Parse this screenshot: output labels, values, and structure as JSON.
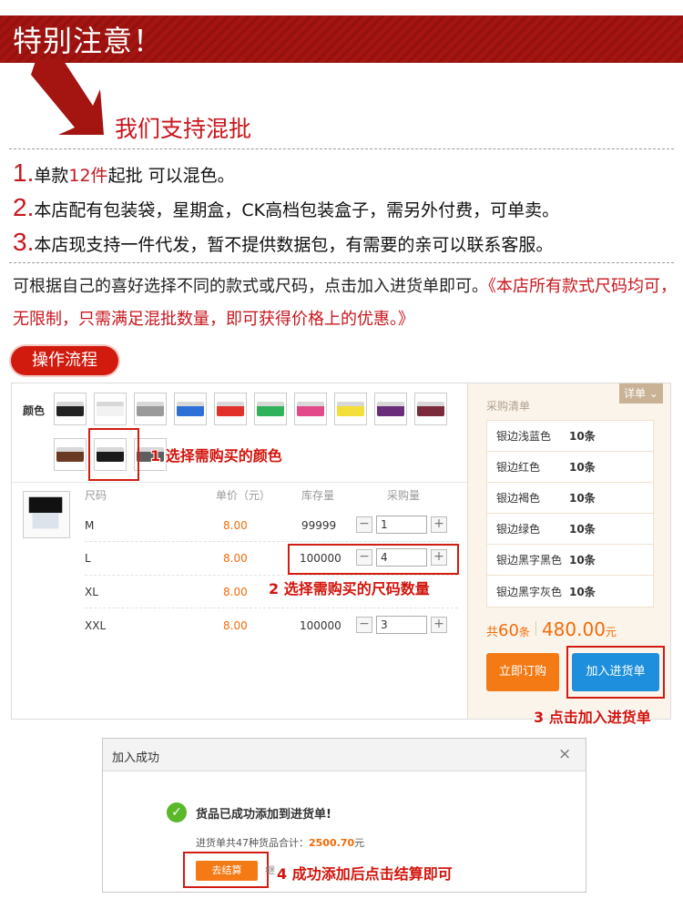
{
  "banner": {
    "title": "特别注意！"
  },
  "subtitle": "我们支持混批",
  "rules": [
    {
      "num": "1.",
      "pre": "单款",
      "hl": "12件",
      "post": "起批 可以混色。"
    },
    {
      "num": "2.",
      "pre": "本店配有包装袋，星期盒，CK高档包装盒子，需另外付费，可单卖。",
      "hl": "",
      "post": ""
    },
    {
      "num": "3.",
      "pre": "本店现支持一件代发，暂不提供数据包，有需要的亲可以联系客服。",
      "hl": "",
      "post": ""
    }
  ],
  "note": {
    "plain": "可根据自己的喜好选择不同的款式或尺码，点击加入进货单即可。",
    "red": "《本店所有款式尺码均可，无限制，只需满足混批数量，即可获得价格上的优惠。》"
  },
  "flow_label": "操作流程",
  "panel": {
    "color_label": "颜色",
    "swatches": [
      {
        "color": "#222222"
      },
      {
        "color": "#f2f2f2"
      },
      {
        "color": "#9a9a9a"
      },
      {
        "color": "#2f6fd8"
      },
      {
        "color": "#e2302a"
      },
      {
        "color": "#2fb25a"
      },
      {
        "color": "#e24a8a"
      },
      {
        "color": "#f2df3a"
      },
      {
        "color": "#6a2d7a"
      },
      {
        "color": "#7a2a3a"
      },
      {
        "color": "#6b3a24"
      },
      {
        "color": "#1a1a1a"
      },
      {
        "color": "#5e5e5e"
      }
    ],
    "headers": {
      "size": "尺码",
      "price": "单价（元）",
      "stock": "库存量",
      "buy": "采购量"
    },
    "rows": [
      {
        "size": "M",
        "price": "8.00",
        "stock": "99999",
        "qty": "1"
      },
      {
        "size": "L",
        "price": "8.00",
        "stock": "100000",
        "qty": "4"
      },
      {
        "size": "XL",
        "price": "8.00",
        "stock": "",
        "qty": ""
      },
      {
        "size": "XXL",
        "price": "8.00",
        "stock": "100000",
        "qty": "3"
      }
    ],
    "minus": "−",
    "plus": "+",
    "callouts": {
      "step1": "1 选择需购买的颜色",
      "step2": "2 选择需购买的尺码数量",
      "step3": "3 点击加入进货单",
      "step4": "4 成功添加后点击结算即可"
    },
    "purchase": {
      "title": "采购清单",
      "detail_btn": "详单",
      "items": [
        {
          "name": "银边浅蓝色",
          "count": "10条"
        },
        {
          "name": "银边红色",
          "count": "10条"
        },
        {
          "name": "银边褐色",
          "count": "10条"
        },
        {
          "name": "银边绿色",
          "count": "10条"
        },
        {
          "name": "银边黑字黑色",
          "count": "10条"
        },
        {
          "name": "银边黑字灰色",
          "count": "10条"
        }
      ],
      "total_prefix": "共",
      "total_count": "60",
      "total_unit": "条",
      "total_amount": "480.00",
      "currency": "元",
      "buy_now": "立即订购",
      "add_cart": "加入进货单"
    }
  },
  "dialog": {
    "title": "加入成功",
    "close": "×",
    "message": "货品已成功添加到进货单!",
    "summary_pre": "进货单共47种货品合计：",
    "summary_amount": "2500.70",
    "summary_unit": "元",
    "checkout": "去结算",
    "continue_hint": "继"
  },
  "colors": {
    "brand_red": "#c8161d",
    "orange": "#f26b0a",
    "blue_btn": "#1e8fdc"
  }
}
